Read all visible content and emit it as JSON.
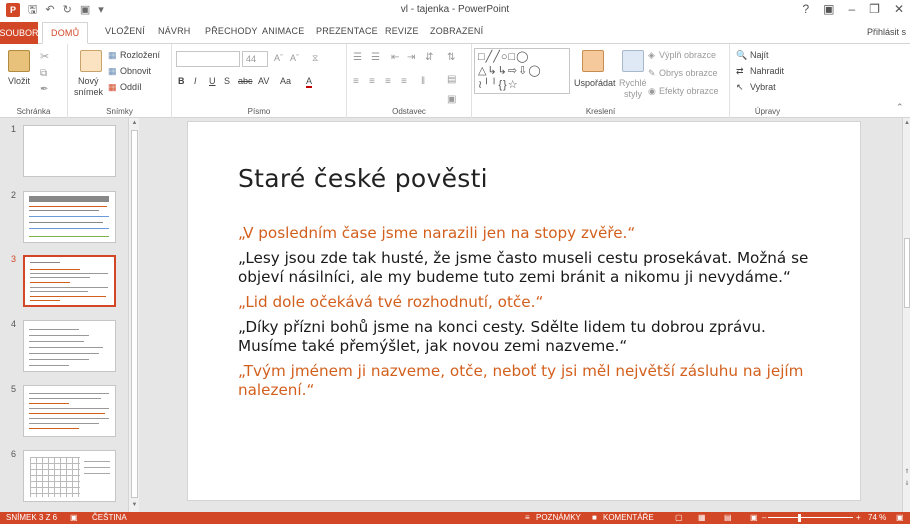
{
  "app": {
    "window_title": "vl - tajenka - PowerPoint",
    "logo_text": "P",
    "quick_access": [
      "save-icon",
      "undo-icon",
      "redo-icon",
      "start-slideshow-icon",
      "customize-icon"
    ],
    "window_controls": [
      "?",
      "▣",
      "–",
      "❐",
      "✕"
    ],
    "sign_in": "Přihlásit s"
  },
  "tabs": {
    "file": "SOUBOR",
    "items": [
      "DOMŮ",
      "VLOŽENÍ",
      "NÁVRH",
      "PŘECHODY",
      "ANIMACE",
      "PREZENTACE",
      "REVIZE",
      "ZOBRAZENÍ"
    ],
    "active": "DOMŮ"
  },
  "ribbon": {
    "clipboard": {
      "paste": "Vložit",
      "label": "Schránka"
    },
    "slides": {
      "new_slide_1": "Nový",
      "new_slide_2": "snímek",
      "layout": "Rozložení",
      "reset": "Obnovit",
      "section": "Oddíl",
      "label": "Snímky"
    },
    "font": {
      "size": "44",
      "bold": "B",
      "italic": "I",
      "underline": "U",
      "shadow": "S",
      "strike": "abc",
      "spacing": "AV",
      "case": "Aa",
      "color": "A",
      "label": "Písmo"
    },
    "paragraph": {
      "label": "Odstavec"
    },
    "drawing": {
      "arrange": "Uspořádat",
      "quick_styles_1": "Rychlé",
      "quick_styles_2": "styly",
      "fill": "Výplň obrazce",
      "outline": "Obrys obrazce",
      "effects": "Efekty obrazce",
      "label": "Kreslení"
    },
    "editing": {
      "find": "Najít",
      "replace": "Nahradit",
      "select": "Vybrat",
      "label": "Úpravy"
    }
  },
  "thumbnails": {
    "numbers": [
      "1",
      "2",
      "3",
      "4",
      "5",
      "6"
    ],
    "active_index": 3
  },
  "slide": {
    "title": "Staré české pověsti",
    "paragraphs": [
      {
        "style": "quote",
        "text": "„V posledním čase jsme narazili jen na stopy zvěře.“"
      },
      {
        "style": "text",
        "text": "„Lesy jsou zde tak husté, že jsme často museli cestu prosekávat. Možná se objeví násilníci, ale my budeme tuto zemi bránit a nikomu ji nevydáme.“"
      },
      {
        "style": "quote",
        "text": "„Lid dole očekává tvé rozhodnutí, otče.“"
      },
      {
        "style": "text",
        "text": "„Díky přízni bohů jsme na konci cesty. Sdělte lidem tu dobrou zprávu. Musíme také přemýšlet, jak novou zemi nazveme.“"
      },
      {
        "style": "quote",
        "text": "„Tvým jménem ji nazveme, otče, neboť ty jsi měl největší zásluhu na jejím nalezení.“"
      }
    ]
  },
  "status": {
    "slide_position": "SNÍMEK 3 Z 6",
    "language": "ČEŠTINA",
    "notes": "POZNÁMKY",
    "comments": "KOMENTÁŘE",
    "zoom": "74 %",
    "zoom_fraction": 0.74,
    "colors": {
      "accent": "#d24726",
      "quote_text": "#d35f1d"
    }
  }
}
